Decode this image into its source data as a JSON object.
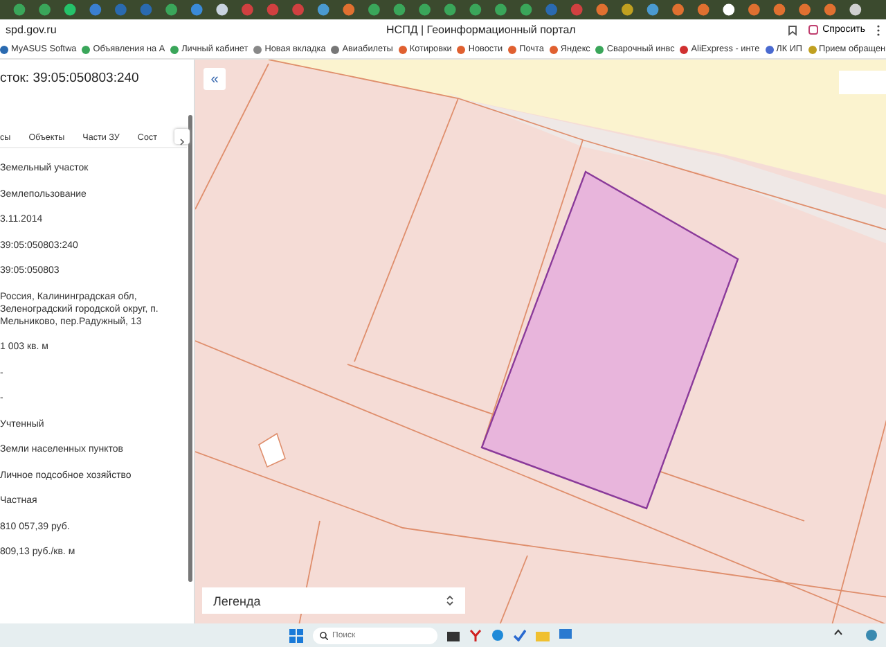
{
  "browser": {
    "url": "spd.gov.ru",
    "page_title": "НСПД | Геоинформационный портал",
    "ask_button": "Спросить",
    "bookmarks": [
      "MyASUS Softwa",
      "Объявления на А",
      "Личный кабинет",
      "Новая вкладка",
      "Авиабилеты",
      "Котировки",
      "Новости",
      "Почта",
      "Яндекс",
      "Сварочный инвс",
      "AliExpress - инте",
      "ЛК ИП",
      "Прием обращен"
    ]
  },
  "panel": {
    "title": "сток: 39:05:050803:240",
    "tabs": [
      "сы",
      "Объекты",
      "Части ЗУ",
      "Сост"
    ],
    "fields": [
      "Земельный участок",
      "Землепользование",
      "3.11.2014",
      "39:05:050803:240",
      "39:05:050803",
      "Россия, Калининградская обл, Зеленоградский городской округ, п. Мельниково, пер.Радужный, 13",
      "1 003 кв. м",
      "-",
      "-",
      "Учтенный",
      "Земли населенных пунктов",
      "Личное подсобное хозяйство",
      "Частная",
      "810 057,39 руб.",
      "809,13 руб./кв. м"
    ]
  },
  "map": {
    "collapse_icon": "«",
    "legend": "Легенда"
  },
  "taskbar": {
    "search_placeholder": "Поиск"
  }
}
